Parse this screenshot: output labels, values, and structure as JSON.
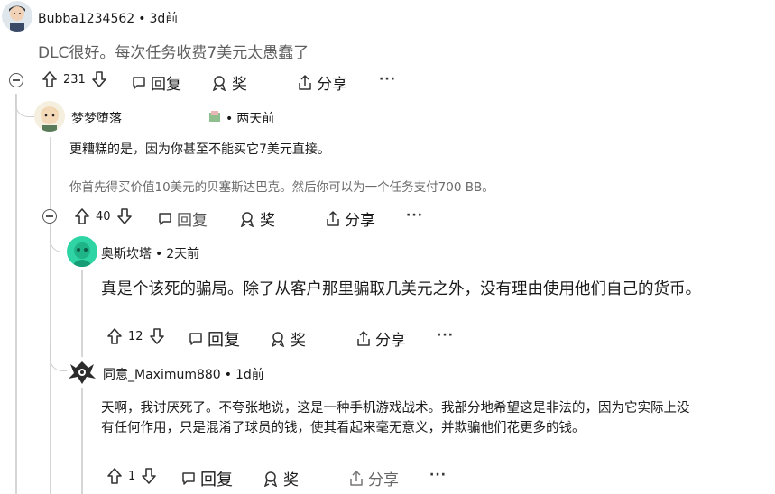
{
  "comments": [
    {
      "username": "Bubba1234562",
      "time": "3d前",
      "body": [
        "DLC很好。每次任务收费7美元太愚蠢了"
      ],
      "votes": "231",
      "reply_label": "回复",
      "award_label": "奖",
      "share_label": "分享"
    },
    {
      "username": "梦梦堕落",
      "time": "两天前",
      "body": [
        "更糟糕的是，因为你甚至不能买它7美元直接。",
        "你首先得买价值10美元的贝塞斯达巴克。然后你可以为一个任务支付700 BB。"
      ],
      "votes": "40",
      "reply_label": "回复",
      "award_label": "奖",
      "share_label": "分享"
    },
    {
      "username": "奥斯坎塔",
      "time": "2天前",
      "body": [
        "真是个该死的骗局。除了从客户那里骗取几美元之外，没有理由使用他们自己的货币。"
      ],
      "votes": "12",
      "reply_label": "回复",
      "award_label": "奖",
      "share_label": "分享"
    },
    {
      "username": "同意_Maximum880",
      "time": "1d前",
      "body": [
        "天啊，我讨厌死了。不夸张地说，这是一种手机游戏战术。我部分地希望这是非法的，因为它实际上没",
        "有任何作用，只是混淆了球员的钱，使其看起来毫无意义，并欺骗他们花更多的钱。"
      ],
      "votes": "1",
      "reply_label": "回复",
      "award_label": "奖",
      "share_label": "分享"
    }
  ],
  "separator": "•",
  "more_label": "···",
  "colors": {
    "text": "#1a1a1b",
    "muted": "#6b6b6b",
    "thread": "#d6d6d6"
  }
}
